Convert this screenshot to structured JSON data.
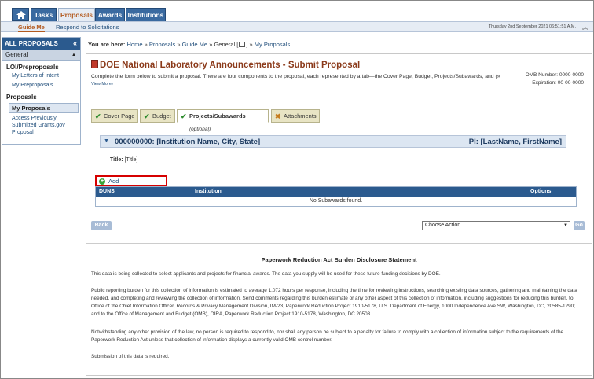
{
  "topnav": {
    "tabs": [
      {
        "label": "Tasks",
        "active": false
      },
      {
        "label": "Proposals",
        "active": true
      },
      {
        "label": "Awards",
        "active": false
      },
      {
        "label": "Institutions",
        "active": false
      }
    ]
  },
  "subnav": {
    "guide_me": "Guide Me",
    "respond": "Respond to Solicitations",
    "datetime": "Thursday 2nd September 2021 06:51:51 A.M."
  },
  "sidebar": {
    "header": "ALL PROPOSALS",
    "general": "General",
    "loi_section": "LOI/Preproposals",
    "my_letters": "My Letters of Intent",
    "my_preproposals": "My Preproposals",
    "proposals_section": "Proposals",
    "my_proposals": "My Proposals",
    "access_grants": "Access Previously Submitted Grants.gov Proposal"
  },
  "breadcrumb": {
    "label": "You are here:",
    "home": "Home",
    "proposals": "Proposals",
    "guide_me": "Guide Me",
    "general": "General [",
    "general_end": "]",
    "my_proposals": "My Proposals",
    "sep": "»"
  },
  "page": {
    "title": "DOE National Laboratory Announcements - Submit Proposal",
    "description": "Complete the form below to submit a proposal. There are four components to the proposal, each represented by a tab—the Cover Page, Budget, Projects/Subawards, and (»",
    "view_more": "View More)",
    "omb_number": "OMB Number: 0000-0000",
    "expiration": "Expiration: 00-00-0000"
  },
  "tabs": [
    {
      "label": "Cover Page",
      "status": "complete"
    },
    {
      "label": "Budget",
      "status": "complete"
    },
    {
      "label": "Projects/Subawards",
      "sub": "(optional)",
      "status": "active"
    },
    {
      "label": "Attachments",
      "status": "incomplete"
    }
  ],
  "institution": {
    "name": "000000000: [Institution Name, City, State]",
    "pi": "PI: [LastName, FirstName]",
    "title_label": "Title:",
    "title_value": "[Title]"
  },
  "subawards": {
    "add_label": "Add Project/Subaward",
    "columns": [
      "DUNS",
      "Institution",
      "Options"
    ],
    "empty": "No Subawards found."
  },
  "actions": {
    "back": "Back",
    "choose_action": "Choose Action",
    "go": "Go"
  },
  "pra": {
    "title": "Paperwork Reduction Act Burden Disclosure Statement",
    "p1": "This data is being collected to select applicants and projects for financial awards. The data you supply will be used for these future funding decisions by DOE.",
    "p2": "Public reporting burden for this collection of information is estimated to average 1.072 hours per response, including the time for reviewing instructions, searching existing data sources, gathering and maintaining the data needed, and completing and reviewing the collection of information. Send comments regarding this burden estimate or any other aspect of this collection of information, including suggestions for reducing this burden, to Office of the Chief Information Officer, Records & Privacy Management Division, IM-23, Paperwork Reduction Project 1910-5178, U.S. Department of Energy, 1000 Independence Ave SW, Washington, DC, 20585-1290; and to the Office of Management and Budget (OMB), OIRA, Paperwork Reduction Project 1910-5178, Washington, DC 20503.",
    "p3": "Notwithstanding any other provision of the law, no person is required to respond to, nor shall any person be subject to a penalty for failure to comply with a collection of information subject to the requirements of the Paperwork Reduction Act unless that collection of information displays a currently valid OMB control number.",
    "p4": "Submission of this data is required."
  }
}
